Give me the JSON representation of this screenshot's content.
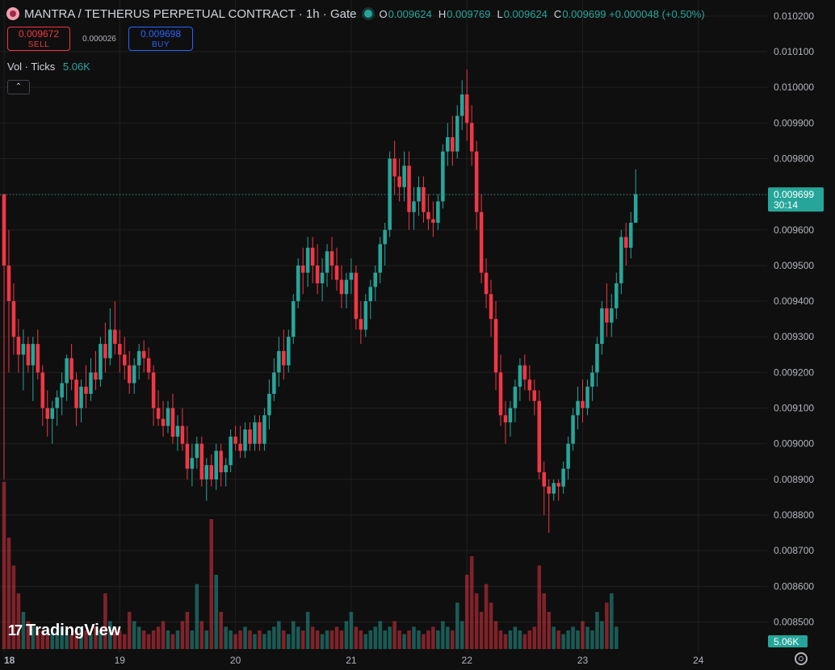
{
  "header": {
    "title": "MANTRA / TETHERUS PERPETUAL CONTRACT · 1h · Gate",
    "ohlc": [
      {
        "k": "O",
        "v": "0.009624"
      },
      {
        "k": "H",
        "v": "0.009769"
      },
      {
        "k": "L",
        "v": "0.009624"
      },
      {
        "k": "C",
        "v": "0.009699 +0.000048 (+0.50%)"
      }
    ]
  },
  "trade": {
    "sell_price": "0.009672",
    "sell_label": "SELL",
    "spread": "0.000026",
    "buy_price": "0.009698",
    "buy_label": "BUY"
  },
  "volume": {
    "label": "Vol · Ticks",
    "value": "5.06K"
  },
  "collapse_icon": "chevron-up",
  "brand": {
    "name": "TradingView"
  },
  "colors": {
    "up": "#26a69a",
    "down": "#f23645",
    "bg": "#0f0f0f",
    "grid": "#1f1f1f"
  },
  "chart_data": {
    "type": "candlestick",
    "y_ticks": [
      "0.010200",
      "0.010100",
      "0.010000",
      "0.009900",
      "0.009800",
      "0.009700",
      "0.009600",
      "0.009500",
      "0.009400",
      "0.009300",
      "0.009200",
      "0.009100",
      "0.009000",
      "0.008900",
      "0.008800",
      "0.008700",
      "0.008600",
      "0.008500"
    ],
    "ylim": [
      0.008415,
      0.010245
    ],
    "x_tick_labels": [
      {
        "label": "18",
        "day": 0
      },
      {
        "label": "19",
        "day": 1
      },
      {
        "label": "20",
        "day": 2
      },
      {
        "label": "21",
        "day": 3
      },
      {
        "label": "22",
        "day": 4
      },
      {
        "label": "23",
        "day": 5
      },
      {
        "label": "24",
        "day": 6
      }
    ],
    "last_price": {
      "value": 0.009699,
      "label": "0.009699",
      "countdown": "30:14"
    },
    "volume_last_label": "5.06K",
    "points_per_day": 24,
    "ohlc": [
      [
        0.0097,
        0.0097,
        0.0089,
        0.0095
      ],
      [
        0.0095,
        0.0096,
        0.0092,
        0.0094
      ],
      [
        0.0094,
        0.00945,
        0.00925,
        0.0093
      ],
      [
        0.0093,
        0.00935,
        0.0092,
        0.00925
      ],
      [
        0.00925,
        0.00932,
        0.00915,
        0.00928
      ],
      [
        0.00928,
        0.0093,
        0.0092,
        0.00922
      ],
      [
        0.00922,
        0.0093,
        0.00912,
        0.00928
      ],
      [
        0.00928,
        0.00932,
        0.00918,
        0.0092
      ],
      [
        0.0092,
        0.00922,
        0.00905,
        0.0091
      ],
      [
        0.0091,
        0.00915,
        0.00902,
        0.00907
      ],
      [
        0.00907,
        0.00912,
        0.009,
        0.0091
      ],
      [
        0.0091,
        0.00915,
        0.00905,
        0.00913
      ],
      [
        0.00913,
        0.0092,
        0.00908,
        0.00917
      ],
      [
        0.00917,
        0.00925,
        0.00912,
        0.00924
      ],
      [
        0.00924,
        0.00928,
        0.00915,
        0.00918
      ],
      [
        0.00918,
        0.0092,
        0.00905,
        0.0091
      ],
      [
        0.0091,
        0.00918,
        0.00906,
        0.00916
      ],
      [
        0.00916,
        0.00922,
        0.0091,
        0.00914
      ],
      [
        0.00914,
        0.00924,
        0.00912,
        0.0092
      ],
      [
        0.0092,
        0.00926,
        0.00915,
        0.00918
      ],
      [
        0.00918,
        0.0093,
        0.00916,
        0.00928
      ],
      [
        0.00928,
        0.00934,
        0.0092,
        0.00924
      ],
      [
        0.00924,
        0.00938,
        0.00922,
        0.00932
      ],
      [
        0.00932,
        0.0094,
        0.00925,
        0.00928
      ],
      [
        0.00928,
        0.00932,
        0.0092,
        0.00925
      ],
      [
        0.00925,
        0.0093,
        0.00918,
        0.00922
      ],
      [
        0.00922,
        0.00926,
        0.00914,
        0.00917
      ],
      [
        0.00917,
        0.00924,
        0.00914,
        0.00922
      ],
      [
        0.00922,
        0.00928,
        0.00918,
        0.00926
      ],
      [
        0.00926,
        0.00929,
        0.0092,
        0.00924
      ],
      [
        0.00924,
        0.00927,
        0.00918,
        0.0092
      ],
      [
        0.0092,
        0.00922,
        0.00905,
        0.0091
      ],
      [
        0.0091,
        0.00915,
        0.00905,
        0.00907
      ],
      [
        0.00907,
        0.00912,
        0.00902,
        0.00905
      ],
      [
        0.00905,
        0.00912,
        0.00903,
        0.0091
      ],
      [
        0.0091,
        0.00914,
        0.009,
        0.00902
      ],
      [
        0.00902,
        0.00908,
        0.00898,
        0.00905
      ],
      [
        0.00905,
        0.0091,
        0.00898,
        0.009
      ],
      [
        0.009,
        0.00905,
        0.0089,
        0.00893
      ],
      [
        0.00893,
        0.009,
        0.00888,
        0.00896
      ],
      [
        0.00896,
        0.00902,
        0.00893,
        0.009
      ],
      [
        0.009,
        0.00902,
        0.00888,
        0.0089
      ],
      [
        0.0089,
        0.00896,
        0.00884,
        0.00894
      ],
      [
        0.00894,
        0.00897,
        0.00888,
        0.0089
      ],
      [
        0.0089,
        0.009,
        0.00887,
        0.00898
      ],
      [
        0.00898,
        0.009,
        0.00888,
        0.00892
      ],
      [
        0.00892,
        0.00896,
        0.00888,
        0.00894
      ],
      [
        0.00894,
        0.00904,
        0.00892,
        0.00902
      ],
      [
        0.00902,
        0.00905,
        0.00898,
        0.009
      ],
      [
        0.009,
        0.00905,
        0.00896,
        0.00898
      ],
      [
        0.00898,
        0.00906,
        0.00896,
        0.00904
      ],
      [
        0.00904,
        0.00906,
        0.00898,
        0.009
      ],
      [
        0.009,
        0.00908,
        0.00898,
        0.00906
      ],
      [
        0.00906,
        0.00908,
        0.00898,
        0.009
      ],
      [
        0.009,
        0.0091,
        0.00898,
        0.00908
      ],
      [
        0.00908,
        0.00918,
        0.00904,
        0.00914
      ],
      [
        0.00914,
        0.00924,
        0.00912,
        0.0092
      ],
      [
        0.0092,
        0.0093,
        0.00916,
        0.00926
      ],
      [
        0.00926,
        0.00932,
        0.00918,
        0.00922
      ],
      [
        0.00922,
        0.00932,
        0.0092,
        0.0093
      ],
      [
        0.0093,
        0.00942,
        0.00928,
        0.0094
      ],
      [
        0.0094,
        0.00952,
        0.00938,
        0.0095
      ],
      [
        0.0095,
        0.00955,
        0.00942,
        0.00948
      ],
      [
        0.00948,
        0.00958,
        0.00944,
        0.00955
      ],
      [
        0.00955,
        0.00958,
        0.00945,
        0.0095
      ],
      [
        0.0095,
        0.00956,
        0.00942,
        0.00945
      ],
      [
        0.00945,
        0.00952,
        0.0094,
        0.00948
      ],
      [
        0.00948,
        0.00956,
        0.00944,
        0.00954
      ],
      [
        0.00954,
        0.00958,
        0.00946,
        0.0095
      ],
      [
        0.0095,
        0.00955,
        0.00943,
        0.00946
      ],
      [
        0.00946,
        0.0095,
        0.00938,
        0.00942
      ],
      [
        0.00942,
        0.00948,
        0.00938,
        0.00946
      ],
      [
        0.00946,
        0.00952,
        0.00942,
        0.00948
      ],
      [
        0.00948,
        0.0095,
        0.00932,
        0.00935
      ],
      [
        0.00935,
        0.0094,
        0.00928,
        0.00932
      ],
      [
        0.00932,
        0.00942,
        0.0093,
        0.0094
      ],
      [
        0.0094,
        0.00946,
        0.00935,
        0.00944
      ],
      [
        0.00944,
        0.0095,
        0.0094,
        0.00948
      ],
      [
        0.00948,
        0.00958,
        0.00945,
        0.00956
      ],
      [
        0.00956,
        0.00962,
        0.0095,
        0.0096
      ],
      [
        0.0096,
        0.00982,
        0.00958,
        0.0098
      ],
      [
        0.0098,
        0.00985,
        0.0097,
        0.00975
      ],
      [
        0.00975,
        0.0098,
        0.00968,
        0.00972
      ],
      [
        0.00972,
        0.00982,
        0.00968,
        0.00978
      ],
      [
        0.00978,
        0.00982,
        0.0096,
        0.00965
      ],
      [
        0.00965,
        0.00972,
        0.0096,
        0.00968
      ],
      [
        0.00968,
        0.00975,
        0.00964,
        0.00972
      ],
      [
        0.00972,
        0.00975,
        0.00962,
        0.00965
      ],
      [
        0.00965,
        0.0097,
        0.0096,
        0.00963
      ],
      [
        0.00963,
        0.00968,
        0.00958,
        0.00962
      ],
      [
        0.00962,
        0.0097,
        0.0096,
        0.00968
      ],
      [
        0.00968,
        0.00984,
        0.00966,
        0.00982
      ],
      [
        0.00982,
        0.0099,
        0.00978,
        0.00986
      ],
      [
        0.00986,
        0.00992,
        0.00978,
        0.00982
      ],
      [
        0.00982,
        0.00995,
        0.0098,
        0.00992
      ],
      [
        0.00992,
        0.01002,
        0.00988,
        0.00998
      ],
      [
        0.00998,
        0.01005,
        0.00985,
        0.0099
      ],
      [
        0.0099,
        0.00995,
        0.00978,
        0.00982
      ],
      [
        0.00982,
        0.00985,
        0.0096,
        0.00965
      ],
      [
        0.00965,
        0.0097,
        0.00945,
        0.00948
      ],
      [
        0.00948,
        0.00952,
        0.00938,
        0.00942
      ],
      [
        0.00942,
        0.00946,
        0.0093,
        0.00935
      ],
      [
        0.00935,
        0.0094,
        0.00915,
        0.0092
      ],
      [
        0.0092,
        0.00925,
        0.00905,
        0.00908
      ],
      [
        0.00908,
        0.00912,
        0.009,
        0.00906
      ],
      [
        0.00906,
        0.00912,
        0.00902,
        0.0091
      ],
      [
        0.0091,
        0.00918,
        0.00906,
        0.00916
      ],
      [
        0.00916,
        0.00924,
        0.00912,
        0.00922
      ],
      [
        0.00922,
        0.00925,
        0.00915,
        0.00918
      ],
      [
        0.00918,
        0.00922,
        0.00912,
        0.00915
      ],
      [
        0.00915,
        0.00918,
        0.00908,
        0.00912
      ],
      [
        0.00912,
        0.00915,
        0.0089,
        0.00892
      ],
      [
        0.00892,
        0.00895,
        0.0088,
        0.00888
      ],
      [
        0.00888,
        0.0089,
        0.00875,
        0.00886
      ],
      [
        0.00886,
        0.0089,
        0.00884,
        0.00889
      ],
      [
        0.00889,
        0.0089,
        0.00884,
        0.00888
      ],
      [
        0.00888,
        0.00895,
        0.00886,
        0.00893
      ],
      [
        0.00893,
        0.00902,
        0.0089,
        0.009
      ],
      [
        0.009,
        0.0091,
        0.00898,
        0.00908
      ],
      [
        0.00908,
        0.00916,
        0.00904,
        0.00912
      ],
      [
        0.00912,
        0.00918,
        0.00906,
        0.0091
      ],
      [
        0.0091,
        0.00918,
        0.00908,
        0.00916
      ],
      [
        0.00916,
        0.00922,
        0.00912,
        0.0092
      ],
      [
        0.0092,
        0.0093,
        0.00916,
        0.00928
      ],
      [
        0.00928,
        0.0094,
        0.00925,
        0.00938
      ],
      [
        0.00938,
        0.00945,
        0.0093,
        0.00934
      ],
      [
        0.00934,
        0.00942,
        0.0093,
        0.00938
      ],
      [
        0.00938,
        0.00948,
        0.00935,
        0.00945
      ],
      [
        0.00945,
        0.0096,
        0.00942,
        0.00958
      ],
      [
        0.00958,
        0.00962,
        0.0095,
        0.00955
      ],
      [
        0.00955,
        0.00965,
        0.00952,
        0.00962
      ],
      [
        0.00962,
        0.00977,
        0.00962,
        0.0097
      ]
    ],
    "volume": [
      0.9,
      0.6,
      0.45,
      0.3,
      0.2,
      0.15,
      0.12,
      0.1,
      0.1,
      0.08,
      0.08,
      0.1,
      0.12,
      0.1,
      0.08,
      0.1,
      0.12,
      0.1,
      0.08,
      0.12,
      0.1,
      0.3,
      0.15,
      0.12,
      0.1,
      0.08,
      0.2,
      0.15,
      0.12,
      0.1,
      0.08,
      0.1,
      0.12,
      0.15,
      0.1,
      0.08,
      0.1,
      0.15,
      0.2,
      0.1,
      0.35,
      0.15,
      0.1,
      0.7,
      0.4,
      0.2,
      0.12,
      0.1,
      0.08,
      0.1,
      0.12,
      0.1,
      0.08,
      0.1,
      0.08,
      0.1,
      0.12,
      0.15,
      0.1,
      0.08,
      0.15,
      0.12,
      0.1,
      0.2,
      0.12,
      0.1,
      0.08,
      0.1,
      0.1,
      0.12,
      0.1,
      0.15,
      0.2,
      0.12,
      0.1,
      0.08,
      0.1,
      0.12,
      0.15,
      0.1,
      0.12,
      0.15,
      0.1,
      0.08,
      0.1,
      0.12,
      0.1,
      0.08,
      0.1,
      0.12,
      0.1,
      0.15,
      0.12,
      0.1,
      0.25,
      0.15,
      0.4,
      0.5,
      0.3,
      0.2,
      0.35,
      0.25,
      0.15,
      0.1,
      0.08,
      0.1,
      0.12,
      0.1,
      0.08,
      0.1,
      0.12,
      0.45,
      0.3,
      0.2,
      0.12,
      0.1,
      0.08,
      0.1,
      0.12,
      0.1,
      0.15,
      0.12,
      0.1,
      0.2,
      0.15,
      0.25,
      0.3,
      0.12
    ]
  }
}
